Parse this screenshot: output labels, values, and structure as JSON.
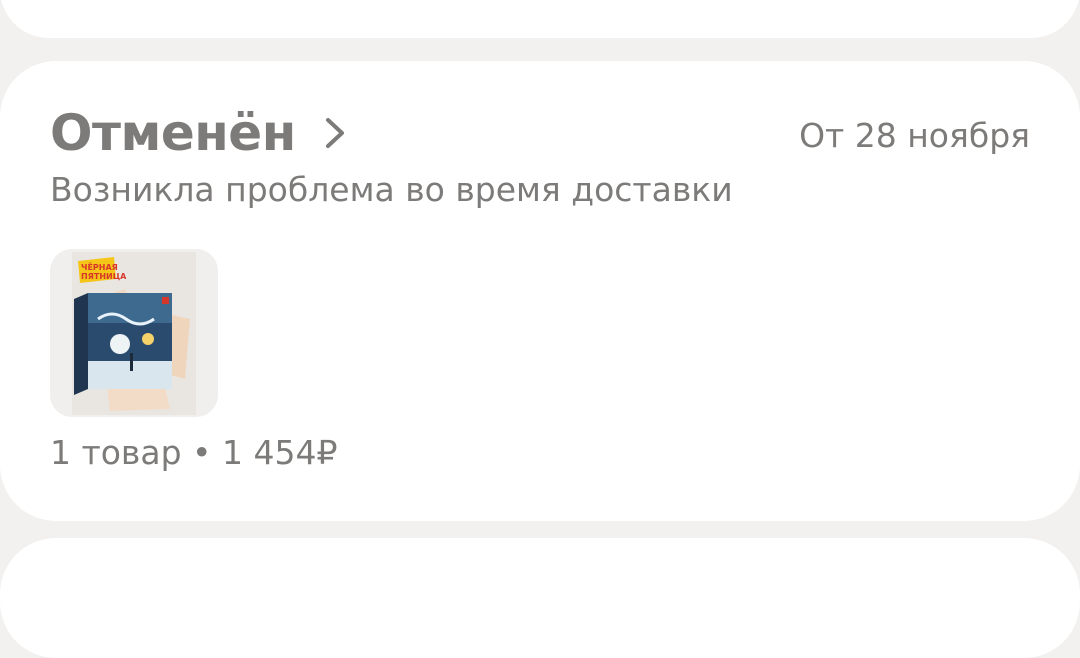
{
  "order": {
    "status_title": "Отменён",
    "date": "От 28 ноября",
    "reason": "Возникла проблема во время доставки",
    "product_image": {
      "icon": "board-game-box-image",
      "badge_line1": "ЧЁРНАЯ",
      "badge_line2": "ПЯТНИЦА"
    },
    "summary": {
      "items_count": "1 товар",
      "separator": " • ",
      "price": "1 454₽"
    }
  },
  "colors": {
    "background": "#f2f1ef",
    "card": "#ffffff",
    "text_muted": "#7c7b79",
    "badge": "#f5c518"
  }
}
